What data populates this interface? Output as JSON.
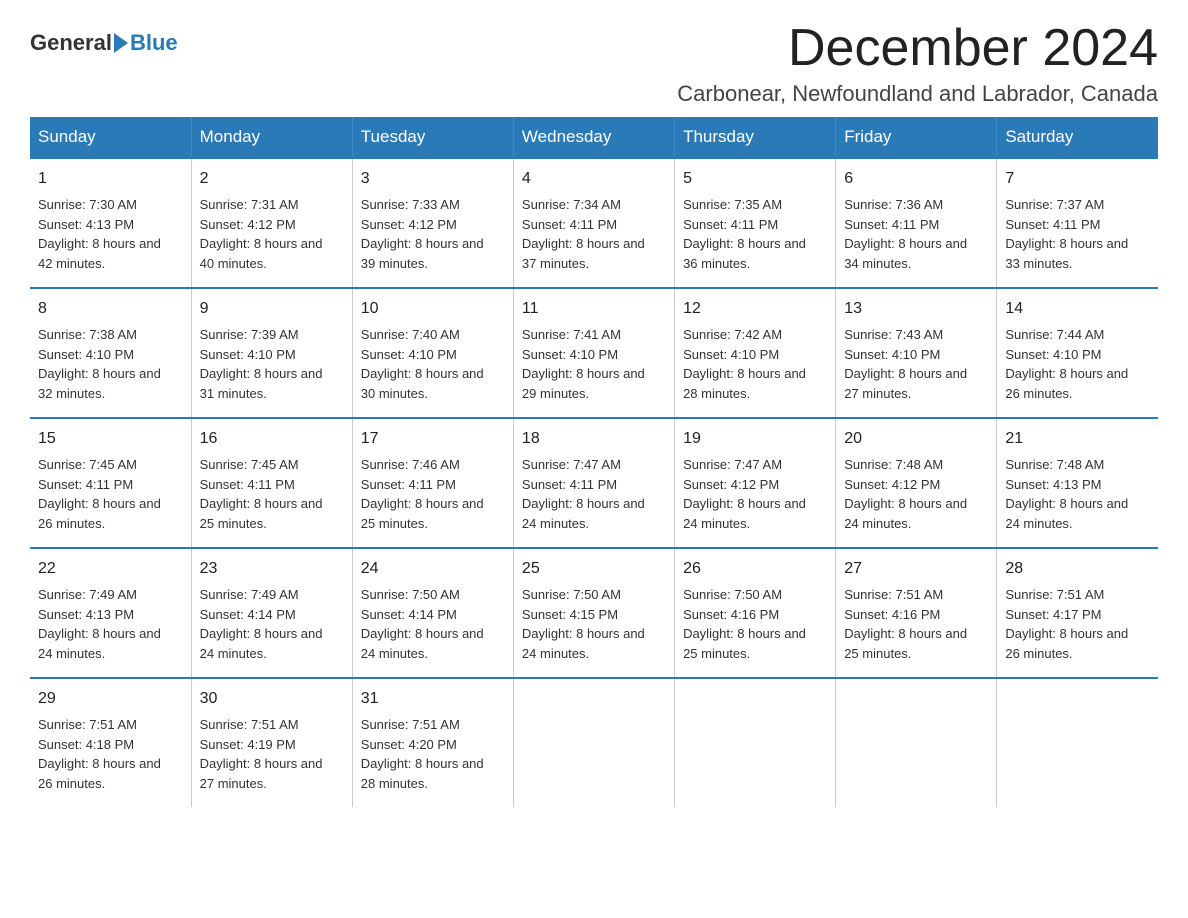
{
  "logo": {
    "general": "General",
    "blue": "Blue"
  },
  "header": {
    "month": "December 2024",
    "location": "Carbonear, Newfoundland and Labrador, Canada"
  },
  "days_of_week": [
    "Sunday",
    "Monday",
    "Tuesday",
    "Wednesday",
    "Thursday",
    "Friday",
    "Saturday"
  ],
  "weeks": [
    [
      {
        "day": "1",
        "sunrise": "Sunrise: 7:30 AM",
        "sunset": "Sunset: 4:13 PM",
        "daylight": "Daylight: 8 hours and 42 minutes."
      },
      {
        "day": "2",
        "sunrise": "Sunrise: 7:31 AM",
        "sunset": "Sunset: 4:12 PM",
        "daylight": "Daylight: 8 hours and 40 minutes."
      },
      {
        "day": "3",
        "sunrise": "Sunrise: 7:33 AM",
        "sunset": "Sunset: 4:12 PM",
        "daylight": "Daylight: 8 hours and 39 minutes."
      },
      {
        "day": "4",
        "sunrise": "Sunrise: 7:34 AM",
        "sunset": "Sunset: 4:11 PM",
        "daylight": "Daylight: 8 hours and 37 minutes."
      },
      {
        "day": "5",
        "sunrise": "Sunrise: 7:35 AM",
        "sunset": "Sunset: 4:11 PM",
        "daylight": "Daylight: 8 hours and 36 minutes."
      },
      {
        "day": "6",
        "sunrise": "Sunrise: 7:36 AM",
        "sunset": "Sunset: 4:11 PM",
        "daylight": "Daylight: 8 hours and 34 minutes."
      },
      {
        "day": "7",
        "sunrise": "Sunrise: 7:37 AM",
        "sunset": "Sunset: 4:11 PM",
        "daylight": "Daylight: 8 hours and 33 minutes."
      }
    ],
    [
      {
        "day": "8",
        "sunrise": "Sunrise: 7:38 AM",
        "sunset": "Sunset: 4:10 PM",
        "daylight": "Daylight: 8 hours and 32 minutes."
      },
      {
        "day": "9",
        "sunrise": "Sunrise: 7:39 AM",
        "sunset": "Sunset: 4:10 PM",
        "daylight": "Daylight: 8 hours and 31 minutes."
      },
      {
        "day": "10",
        "sunrise": "Sunrise: 7:40 AM",
        "sunset": "Sunset: 4:10 PM",
        "daylight": "Daylight: 8 hours and 30 minutes."
      },
      {
        "day": "11",
        "sunrise": "Sunrise: 7:41 AM",
        "sunset": "Sunset: 4:10 PM",
        "daylight": "Daylight: 8 hours and 29 minutes."
      },
      {
        "day": "12",
        "sunrise": "Sunrise: 7:42 AM",
        "sunset": "Sunset: 4:10 PM",
        "daylight": "Daylight: 8 hours and 28 minutes."
      },
      {
        "day": "13",
        "sunrise": "Sunrise: 7:43 AM",
        "sunset": "Sunset: 4:10 PM",
        "daylight": "Daylight: 8 hours and 27 minutes."
      },
      {
        "day": "14",
        "sunrise": "Sunrise: 7:44 AM",
        "sunset": "Sunset: 4:10 PM",
        "daylight": "Daylight: 8 hours and 26 minutes."
      }
    ],
    [
      {
        "day": "15",
        "sunrise": "Sunrise: 7:45 AM",
        "sunset": "Sunset: 4:11 PM",
        "daylight": "Daylight: 8 hours and 26 minutes."
      },
      {
        "day": "16",
        "sunrise": "Sunrise: 7:45 AM",
        "sunset": "Sunset: 4:11 PM",
        "daylight": "Daylight: 8 hours and 25 minutes."
      },
      {
        "day": "17",
        "sunrise": "Sunrise: 7:46 AM",
        "sunset": "Sunset: 4:11 PM",
        "daylight": "Daylight: 8 hours and 25 minutes."
      },
      {
        "day": "18",
        "sunrise": "Sunrise: 7:47 AM",
        "sunset": "Sunset: 4:11 PM",
        "daylight": "Daylight: 8 hours and 24 minutes."
      },
      {
        "day": "19",
        "sunrise": "Sunrise: 7:47 AM",
        "sunset": "Sunset: 4:12 PM",
        "daylight": "Daylight: 8 hours and 24 minutes."
      },
      {
        "day": "20",
        "sunrise": "Sunrise: 7:48 AM",
        "sunset": "Sunset: 4:12 PM",
        "daylight": "Daylight: 8 hours and 24 minutes."
      },
      {
        "day": "21",
        "sunrise": "Sunrise: 7:48 AM",
        "sunset": "Sunset: 4:13 PM",
        "daylight": "Daylight: 8 hours and 24 minutes."
      }
    ],
    [
      {
        "day": "22",
        "sunrise": "Sunrise: 7:49 AM",
        "sunset": "Sunset: 4:13 PM",
        "daylight": "Daylight: 8 hours and 24 minutes."
      },
      {
        "day": "23",
        "sunrise": "Sunrise: 7:49 AM",
        "sunset": "Sunset: 4:14 PM",
        "daylight": "Daylight: 8 hours and 24 minutes."
      },
      {
        "day": "24",
        "sunrise": "Sunrise: 7:50 AM",
        "sunset": "Sunset: 4:14 PM",
        "daylight": "Daylight: 8 hours and 24 minutes."
      },
      {
        "day": "25",
        "sunrise": "Sunrise: 7:50 AM",
        "sunset": "Sunset: 4:15 PM",
        "daylight": "Daylight: 8 hours and 24 minutes."
      },
      {
        "day": "26",
        "sunrise": "Sunrise: 7:50 AM",
        "sunset": "Sunset: 4:16 PM",
        "daylight": "Daylight: 8 hours and 25 minutes."
      },
      {
        "day": "27",
        "sunrise": "Sunrise: 7:51 AM",
        "sunset": "Sunset: 4:16 PM",
        "daylight": "Daylight: 8 hours and 25 minutes."
      },
      {
        "day": "28",
        "sunrise": "Sunrise: 7:51 AM",
        "sunset": "Sunset: 4:17 PM",
        "daylight": "Daylight: 8 hours and 26 minutes."
      }
    ],
    [
      {
        "day": "29",
        "sunrise": "Sunrise: 7:51 AM",
        "sunset": "Sunset: 4:18 PM",
        "daylight": "Daylight: 8 hours and 26 minutes."
      },
      {
        "day": "30",
        "sunrise": "Sunrise: 7:51 AM",
        "sunset": "Sunset: 4:19 PM",
        "daylight": "Daylight: 8 hours and 27 minutes."
      },
      {
        "day": "31",
        "sunrise": "Sunrise: 7:51 AM",
        "sunset": "Sunset: 4:20 PM",
        "daylight": "Daylight: 8 hours and 28 minutes."
      },
      null,
      null,
      null,
      null
    ]
  ]
}
